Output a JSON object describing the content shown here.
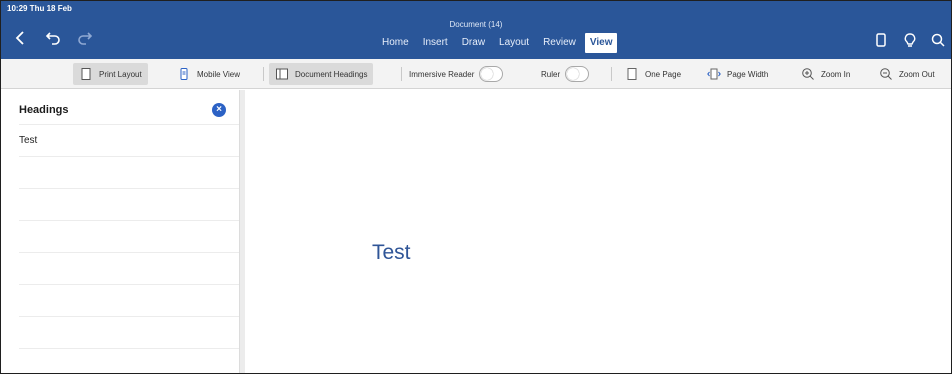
{
  "status": {
    "time": "10:29 Thu 18 Feb"
  },
  "header": {
    "doc_title": "Document (14)"
  },
  "tabs": [
    {
      "label": "Home"
    },
    {
      "label": "Insert"
    },
    {
      "label": "Draw"
    },
    {
      "label": "Layout"
    },
    {
      "label": "Review"
    },
    {
      "label": "View",
      "active": true
    }
  ],
  "ribbon": {
    "print_layout": "Print Layout",
    "mobile_view": "Mobile View",
    "document_headings": "Document Headings",
    "immersive_reader": "Immersive Reader",
    "ruler": "Ruler",
    "one_page": "One Page",
    "page_width": "Page Width",
    "zoom_in": "Zoom In",
    "zoom_out": "Zoom Out"
  },
  "headings_pane": {
    "title": "Headings",
    "items": [
      {
        "label": "Test"
      }
    ]
  },
  "document": {
    "heading": "Test"
  },
  "colors": {
    "header_blue": "#2a5699",
    "accent_blue": "#2c62c5",
    "heading_text": "#2f5597"
  },
  "icons": [
    "back-icon",
    "undo-icon",
    "redo-icon",
    "phone-icon",
    "lightbulb-icon",
    "search-icon"
  ]
}
